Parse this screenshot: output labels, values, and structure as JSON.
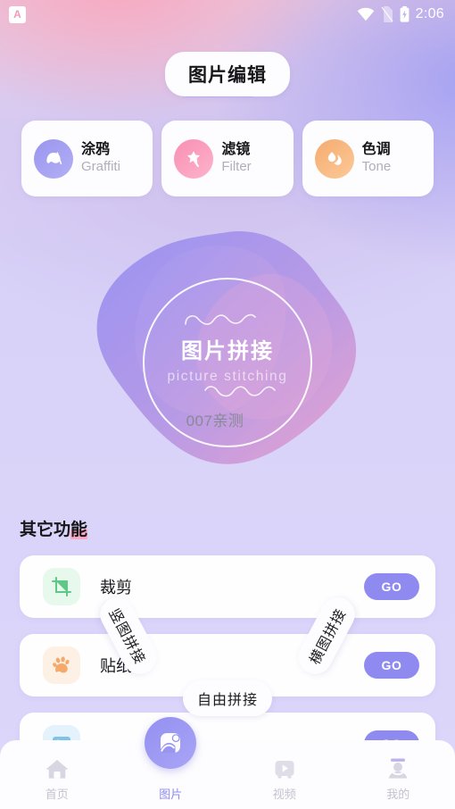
{
  "statusbar": {
    "app_badge_letter": "A",
    "time": "2:06",
    "icons": [
      "wifi-icon",
      "no-sim-icon",
      "battery-charging-icon"
    ]
  },
  "header": {
    "title": "图片编辑"
  },
  "feature_cards": [
    {
      "cn": "涂鸦",
      "en": "Graffiti",
      "icon": "brush-icon",
      "color": "#9a95ef"
    },
    {
      "cn": "滤镜",
      "en": "Filter",
      "icon": "magic-wand-star-icon",
      "color": "#f98fb3"
    },
    {
      "cn": "色调",
      "en": "Tone",
      "icon": "droplet-icon",
      "color": "#f5ab6e"
    }
  ],
  "hero": {
    "title_cn": "图片拼接",
    "title_en": "picture stitching",
    "watermark": "007亲测",
    "pills": [
      {
        "label": "竖图拼接",
        "position": "left"
      },
      {
        "label": "横图拼接",
        "position": "right"
      },
      {
        "label": "自由拼接",
        "position": "bottom"
      }
    ]
  },
  "other_section": {
    "title_prefix": "其它功",
    "title_highlight": "能",
    "rows": [
      {
        "label": "裁剪",
        "icon": "crop-icon",
        "action": "GO",
        "icon_color": "#5fc887"
      },
      {
        "label": "贴纸",
        "icon": "paw-icon",
        "action": "GO",
        "icon_color": "#f5a96b"
      },
      {
        "label": "",
        "icon": "picture-icon",
        "action": "GO",
        "icon_color": "#7fc2e8"
      }
    ]
  },
  "bottom_nav": [
    {
      "label": "首页",
      "icon": "home-icon",
      "active": false
    },
    {
      "label": "图片",
      "icon": "picture-icon",
      "active": true
    },
    {
      "label": "视频",
      "icon": "video-icon",
      "active": false
    },
    {
      "label": "我的",
      "icon": "person-icon",
      "active": false
    }
  ],
  "colors": {
    "accent": "#8e8af0",
    "pink": "#f9a9c4",
    "orange": "#f5ab6e"
  }
}
